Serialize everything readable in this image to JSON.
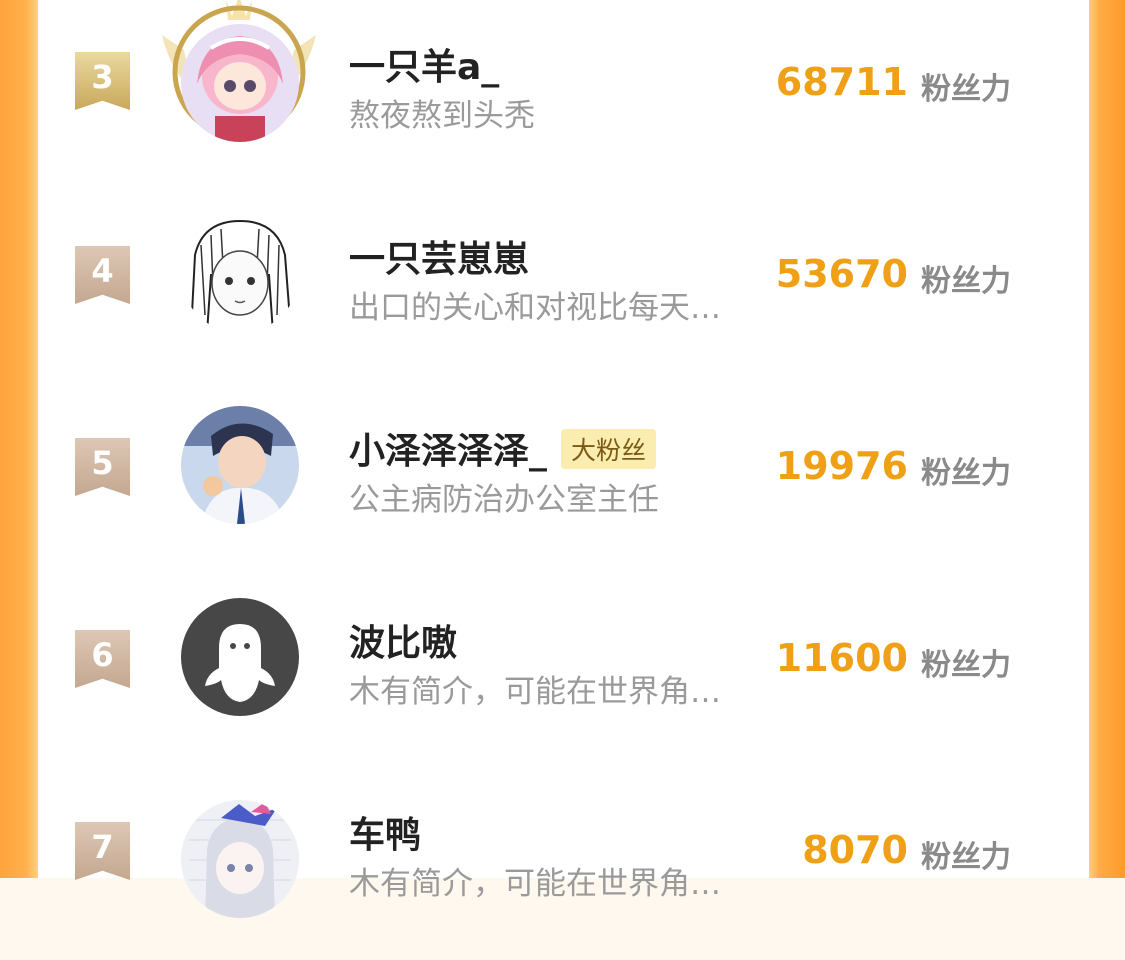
{
  "score_unit": "粉丝力",
  "users": [
    {
      "rank": "3",
      "name": "一只羊a_",
      "bio": "熬夜熬到头秃",
      "score": "68711",
      "badge": ""
    },
    {
      "rank": "4",
      "name": "一只芸崽崽",
      "bio": "出口的关心和对视比每天…",
      "score": "53670",
      "badge": ""
    },
    {
      "rank": "5",
      "name": "小泽泽泽泽_",
      "bio": "公主病防治办公室主任",
      "score": "19976",
      "badge": "大粉丝"
    },
    {
      "rank": "6",
      "name": "波比嗷",
      "bio": "木有简介，可能在世界角…",
      "score": "11600",
      "badge": ""
    },
    {
      "rank": "7",
      "name": "车鸭",
      "bio": "木有简介，可能在世界角…",
      "score": "8070",
      "badge": ""
    }
  ],
  "colors": {
    "accent": "#f0a017",
    "frame": "#ffa33a",
    "rank_gold": "#c9a85a",
    "rank_bronze": "#c4a890",
    "badge_bg": "#fbedb0"
  },
  "icons": {
    "rank_marker": "ribbon-bookmark",
    "top3_frame": "laurel-crown-frame",
    "default_avatar": "ghost-silhouette-icon"
  }
}
